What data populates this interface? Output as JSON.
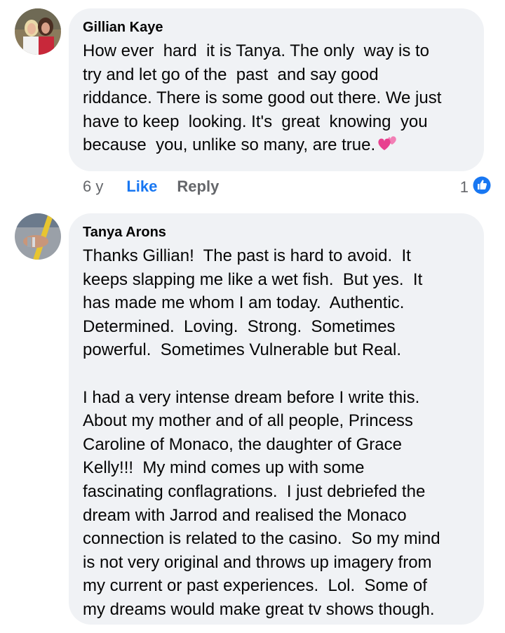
{
  "comments": [
    {
      "author": "Gillian Kaye",
      "text": "How ever  hard  it is Tanya. The only  way is to\ntry and let go of the  past  and say good\nriddance. There is some good out there. We just\nhave to keep  looking. It's  great  knowing  you\nbecause  you, unlike so many, are true.",
      "emoji_icon": "two-hearts-icon",
      "time": "6 y",
      "like_label": "Like",
      "reply_label": "Reply",
      "reaction_count": "1",
      "reaction_icon": "like-reaction-icon"
    },
    {
      "author": "Tanya Arons",
      "text": "Thanks Gillian!  The past is hard to avoid.  It\nkeeps slapping me like a wet fish.  But yes.  It\nhas made me whom I am today.  Authentic.\nDetermined.  Loving.  Strong.  Sometimes\npowerful.  Sometimes Vulnerable but Real.\n\nI had a very intense dream before I write this.\nAbout my mother and of all people, Princess\nCaroline of Monaco, the daughter of Grace\nKelly!!!  My mind comes up with some\nfascinating conflagrations.  I just debriefed the\ndream with Jarrod and realised the Monaco\nconnection is related to the casino.  So my mind\nis not very original and throws up imagery from\nmy current or past experiences.  Lol.  Some of\nmy dreams would make great tv shows though."
    }
  ],
  "colors": {
    "bubble": "#f0f2f5",
    "link": "#1877f2",
    "muted": "#65676b"
  }
}
